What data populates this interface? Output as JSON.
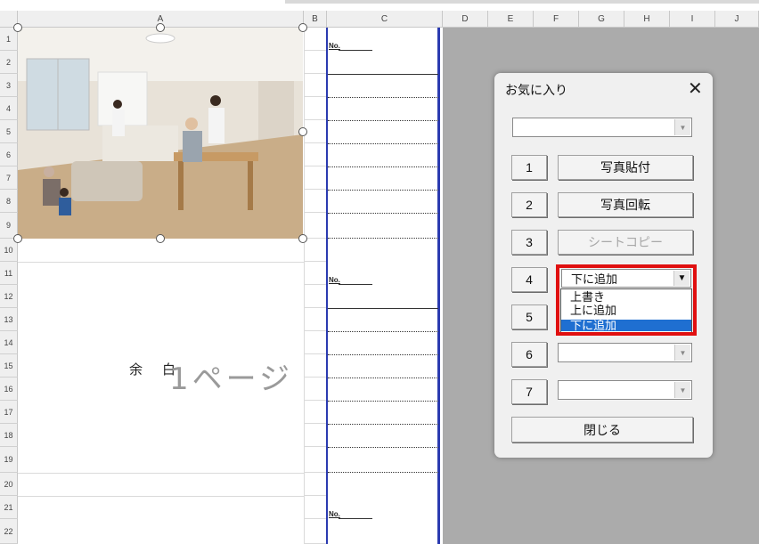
{
  "columns": [
    "A",
    "B",
    "C",
    "D",
    "E",
    "F",
    "G",
    "H",
    "I",
    "J"
  ],
  "rows": [
    "1",
    "2",
    "3",
    "4",
    "5",
    "6",
    "7",
    "8",
    "9",
    "10",
    "11",
    "12",
    "13",
    "14",
    "15",
    "16",
    "17",
    "18",
    "19",
    "20",
    "21",
    "22"
  ],
  "sheet": {
    "no_label": "No.",
    "watermark_text": "余白",
    "watermark_page": "1ページ"
  },
  "dialog": {
    "title": "お気に入り",
    "close_glyph": "✕",
    "top_combo_value": "",
    "buttons": {
      "b1_num": "1",
      "b1_label": "写真貼付",
      "b2_num": "2",
      "b2_label": "写真回転",
      "b3_num": "3",
      "b3_label": "シートコピー",
      "b4_num": "4",
      "b5_num": "5",
      "b6_num": "6",
      "b7_num": "7",
      "close_label": "閉じる"
    },
    "combo4_value": "下に追加",
    "combo4_options": [
      "上書き",
      "上に追加",
      "下に追加"
    ],
    "combo4_selected": "下に追加",
    "combo6_value": "",
    "combo7_value": ""
  },
  "colors": {
    "accent_blue": "#1f6fd1",
    "highlight_red": "#e01010",
    "page_border": "#2b3bb0"
  },
  "icons": {
    "dropdown": "chevron-down-icon",
    "close": "close-icon"
  }
}
